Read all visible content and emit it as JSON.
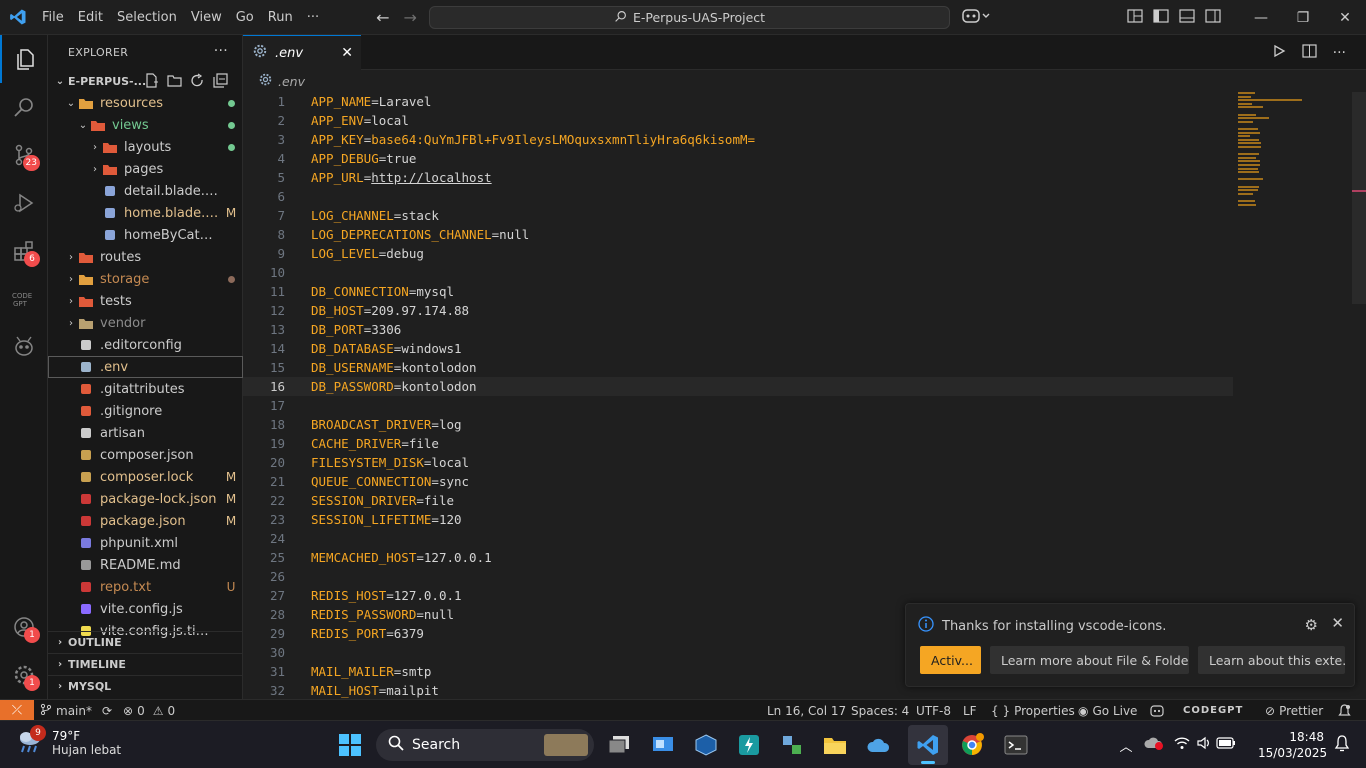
{
  "titlebar": {
    "menu": [
      "File",
      "Edit",
      "Selection",
      "View",
      "Go",
      "Run",
      "···"
    ],
    "search_text": "E-Perpus-UAS-Project"
  },
  "activity_badges": {
    "source_control": "23",
    "extensions": "6",
    "accounts": "1",
    "settings": "1"
  },
  "explorer": {
    "header": "EXPLORER",
    "project": "E-PERPUS-...",
    "items": [
      {
        "name": "resources",
        "stat": "",
        "color": "mod"
      },
      {
        "name": "views",
        "stat": "",
        "color": "m"
      },
      {
        "name": "layouts",
        "stat": "",
        "color": "def"
      },
      {
        "name": "pages",
        "stat": "",
        "color": "def"
      },
      {
        "name": "detail.blade.php",
        "stat": "",
        "color": "def"
      },
      {
        "name": "home.blade.p...",
        "stat": "M",
        "color": "mod"
      },
      {
        "name": "homeByCategory.bl...",
        "stat": "",
        "color": "def"
      },
      {
        "name": "routes",
        "stat": "",
        "color": "def"
      },
      {
        "name": "storage",
        "stat": "",
        "color": "u"
      },
      {
        "name": "tests",
        "stat": "",
        "color": "def"
      },
      {
        "name": "vendor",
        "stat": "",
        "color": "ign"
      },
      {
        "name": ".editorconfig",
        "stat": "",
        "color": "def"
      },
      {
        "name": ".env",
        "stat": "",
        "color": "mod"
      },
      {
        "name": ".gitattributes",
        "stat": "",
        "color": "def"
      },
      {
        "name": ".gitignore",
        "stat": "",
        "color": "def"
      },
      {
        "name": "artisan",
        "stat": "",
        "color": "def"
      },
      {
        "name": "composer.json",
        "stat": "",
        "color": "def"
      },
      {
        "name": "composer.lock",
        "stat": "M",
        "color": "mod"
      },
      {
        "name": "package-lock.json",
        "stat": "M",
        "color": "mod"
      },
      {
        "name": "package.json",
        "stat": "M",
        "color": "mod"
      },
      {
        "name": "phpunit.xml",
        "stat": "",
        "color": "def"
      },
      {
        "name": "README.md",
        "stat": "",
        "color": "def"
      },
      {
        "name": "repo.txt",
        "stat": "U",
        "color": "u"
      },
      {
        "name": "vite.config.js",
        "stat": "",
        "color": "def"
      },
      {
        "name": "vite.config.js.timestam...",
        "stat": "",
        "color": "def"
      }
    ],
    "sections": [
      "OUTLINE",
      "TIMELINE",
      "MYSQL"
    ]
  },
  "editor": {
    "tab_label": ".env",
    "breadcrumb": ".env",
    "lines": [
      {
        "k": "APP_NAME",
        "v": "Laravel"
      },
      {
        "k": "APP_ENV",
        "v": "local"
      },
      {
        "k": "APP_KEY",
        "v": "base64:QuYmJFBl+Fv9IleysLMOquxsxmnTliyHra6q6kisomM="
      },
      {
        "k": "APP_DEBUG",
        "v": "true"
      },
      {
        "k": "APP_URL",
        "v": "http://localhost"
      },
      {
        "k": "",
        "v": ""
      },
      {
        "k": "LOG_CHANNEL",
        "v": "stack"
      },
      {
        "k": "LOG_DEPRECATIONS_CHANNEL",
        "v": "null"
      },
      {
        "k": "LOG_LEVEL",
        "v": "debug"
      },
      {
        "k": "",
        "v": ""
      },
      {
        "k": "DB_CONNECTION",
        "v": "mysql"
      },
      {
        "k": "DB_HOST",
        "v": "209.97.174.88"
      },
      {
        "k": "DB_PORT",
        "v": "3306"
      },
      {
        "k": "DB_DATABASE",
        "v": "windows1"
      },
      {
        "k": "DB_USERNAME",
        "v": "kontolodon"
      },
      {
        "k": "DB_PASSWORD",
        "v": "kontolodon"
      },
      {
        "k": "",
        "v": ""
      },
      {
        "k": "BROADCAST_DRIVER",
        "v": "log"
      },
      {
        "k": "CACHE_DRIVER",
        "v": "file"
      },
      {
        "k": "FILESYSTEM_DISK",
        "v": "local"
      },
      {
        "k": "QUEUE_CONNECTION",
        "v": "sync"
      },
      {
        "k": "SESSION_DRIVER",
        "v": "file"
      },
      {
        "k": "SESSION_LIFETIME",
        "v": "120"
      },
      {
        "k": "",
        "v": ""
      },
      {
        "k": "MEMCACHED_HOST",
        "v": "127.0.0.1"
      },
      {
        "k": "",
        "v": ""
      },
      {
        "k": "REDIS_HOST",
        "v": "127.0.0.1"
      },
      {
        "k": "REDIS_PASSWORD",
        "v": "null"
      },
      {
        "k": "REDIS_PORT",
        "v": "6379"
      },
      {
        "k": "",
        "v": ""
      },
      {
        "k": "MAIL_MAILER",
        "v": "smtp"
      },
      {
        "k": "MAIL_HOST",
        "v": "mailpit"
      }
    ],
    "current_line": 16
  },
  "notification": {
    "message": "Thanks for installing vscode-icons.",
    "btn_primary": "Activ...",
    "btn_learn_file": "Learn more about File & Folder...",
    "btn_learn_ext": "Learn about this exte..."
  },
  "statusbar": {
    "branch": "main*",
    "errors": "0",
    "warnings": "0",
    "position": "Ln 16, Col 17",
    "spaces": "Spaces: 4",
    "encoding": "UTF-8",
    "eol": "LF",
    "language": "Properties",
    "golive": "Go Live",
    "codegpt": "CODEGPT",
    "prettier": "Prettier"
  },
  "taskbar": {
    "weather_badge": "9",
    "temp": "79°F",
    "condition": "Hujan lebat",
    "search": "Search",
    "time": "18:48",
    "date": "15/03/2025"
  },
  "colors": {
    "accent": "#0078d4",
    "env_key": "#f5a623",
    "status_remote": "#e8702a"
  }
}
